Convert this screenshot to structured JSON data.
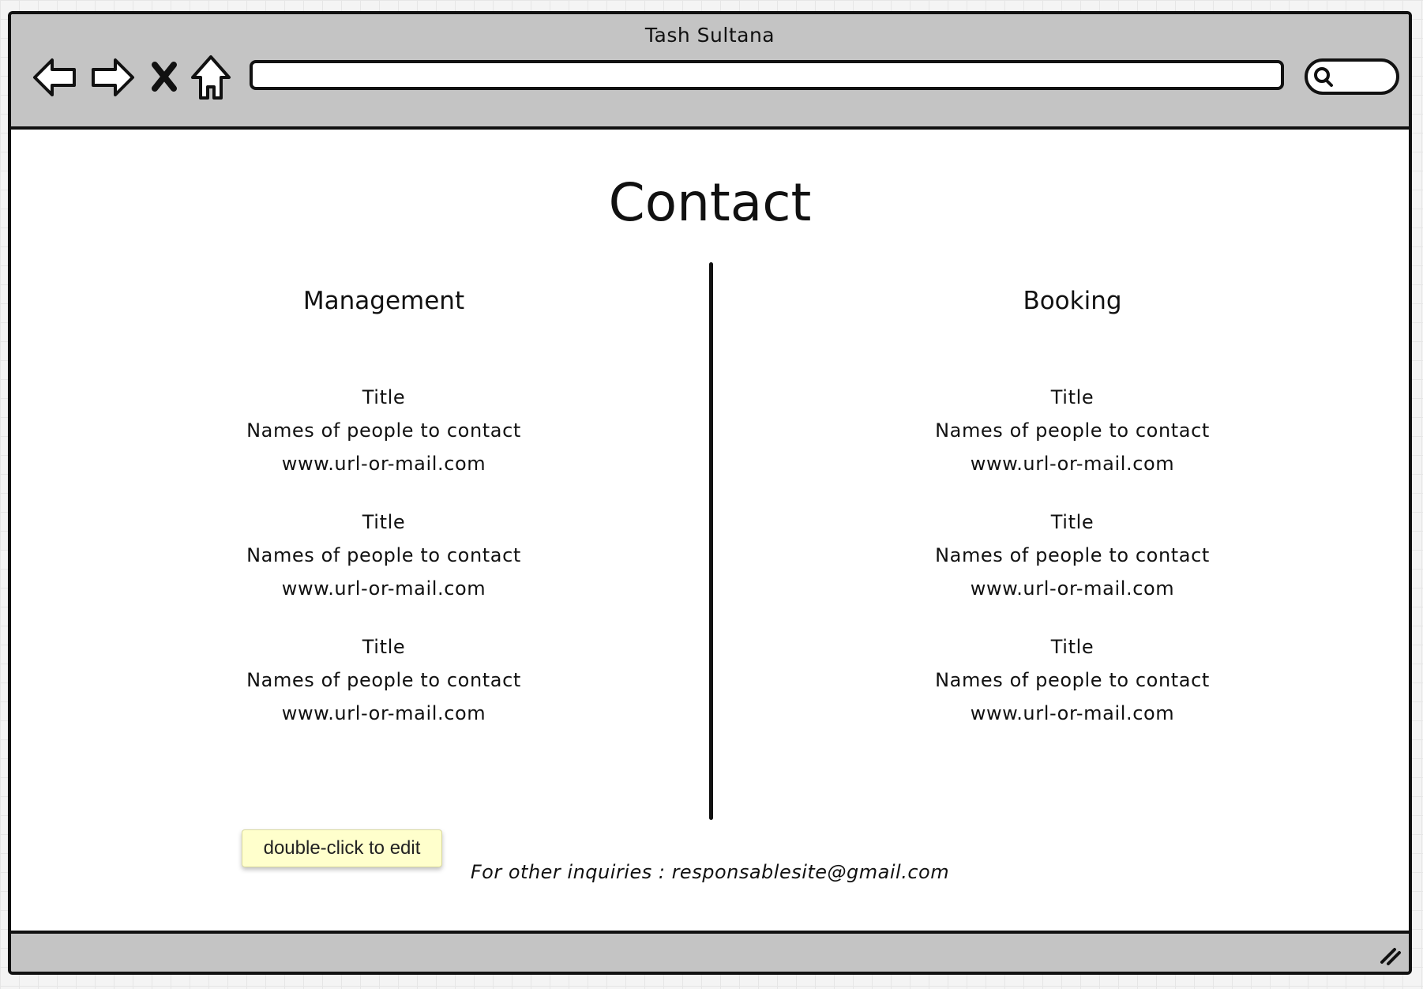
{
  "window": {
    "title": "Tash Sultana"
  },
  "toolbar": {
    "icons": [
      "back-arrow-icon",
      "forward-arrow-icon",
      "close-x-icon",
      "home-icon",
      "search-icon"
    ],
    "address_value": ""
  },
  "page": {
    "title": "Contact",
    "columns": [
      {
        "heading": "Management",
        "entries": [
          {
            "title": "Title",
            "names": "Names of people to contact",
            "url": "www.url-or-mail.com"
          },
          {
            "title": "Title",
            "names": "Names of people to contact",
            "url": "www.url-or-mail.com"
          },
          {
            "title": "Title",
            "names": "Names of people to contact",
            "url": "www.url-or-mail.com"
          }
        ]
      },
      {
        "heading": "Booking",
        "entries": [
          {
            "title": "Title",
            "names": "Names of people to contact",
            "url": "www.url-or-mail.com"
          },
          {
            "title": "Title",
            "names": "Names of people to contact",
            "url": "www.url-or-mail.com"
          },
          {
            "title": "Title",
            "names": "Names of people to contact",
            "url": "www.url-or-mail.com"
          }
        ]
      }
    ],
    "footer_note": "For other inquiries : responsablesite@gmail.com"
  },
  "tooltip": {
    "text": "double-click to edit"
  },
  "colors": {
    "chrome": "#c4c4c4",
    "stroke": "#111111",
    "tooltip_bg": "#ffffcc"
  }
}
